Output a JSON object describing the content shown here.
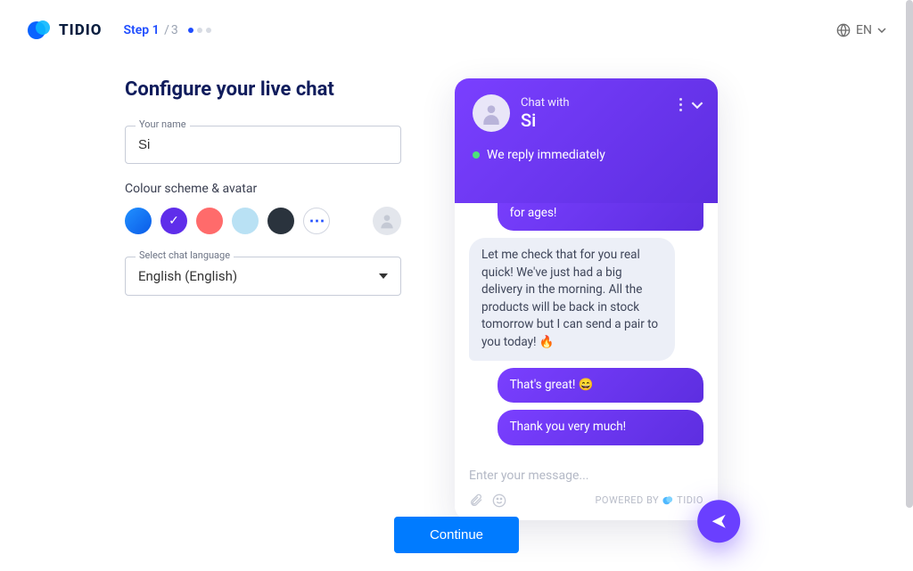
{
  "brand": "TIDIO",
  "step": {
    "current_label": "Step 1",
    "total": "3"
  },
  "lang_switch": "EN",
  "title": "Configure your live chat",
  "name_field": {
    "label": "Your name",
    "value": "Si"
  },
  "scheme_label": "Colour scheme & avatar",
  "colors": {
    "more_label": "⋯"
  },
  "lang_field": {
    "label": "Select chat language",
    "value": "English (English)"
  },
  "chat": {
    "chat_with_small": "Chat with",
    "chat_with_name": "Si",
    "status": "We reply immediately",
    "msg1": "I've been looking for this model for ages!",
    "msg2": "Let me check that for you real quick! We've just had a big delivery in the morning. All the products will be back in stock tomorrow but I can send a pair to you today! 🔥",
    "msg3": "That's great! 😄",
    "msg4": "Thank you very much!",
    "placeholder": "Enter your message...",
    "powered": "POWERED BY",
    "powered_brand": "TIDIO"
  },
  "continue": "Continue"
}
